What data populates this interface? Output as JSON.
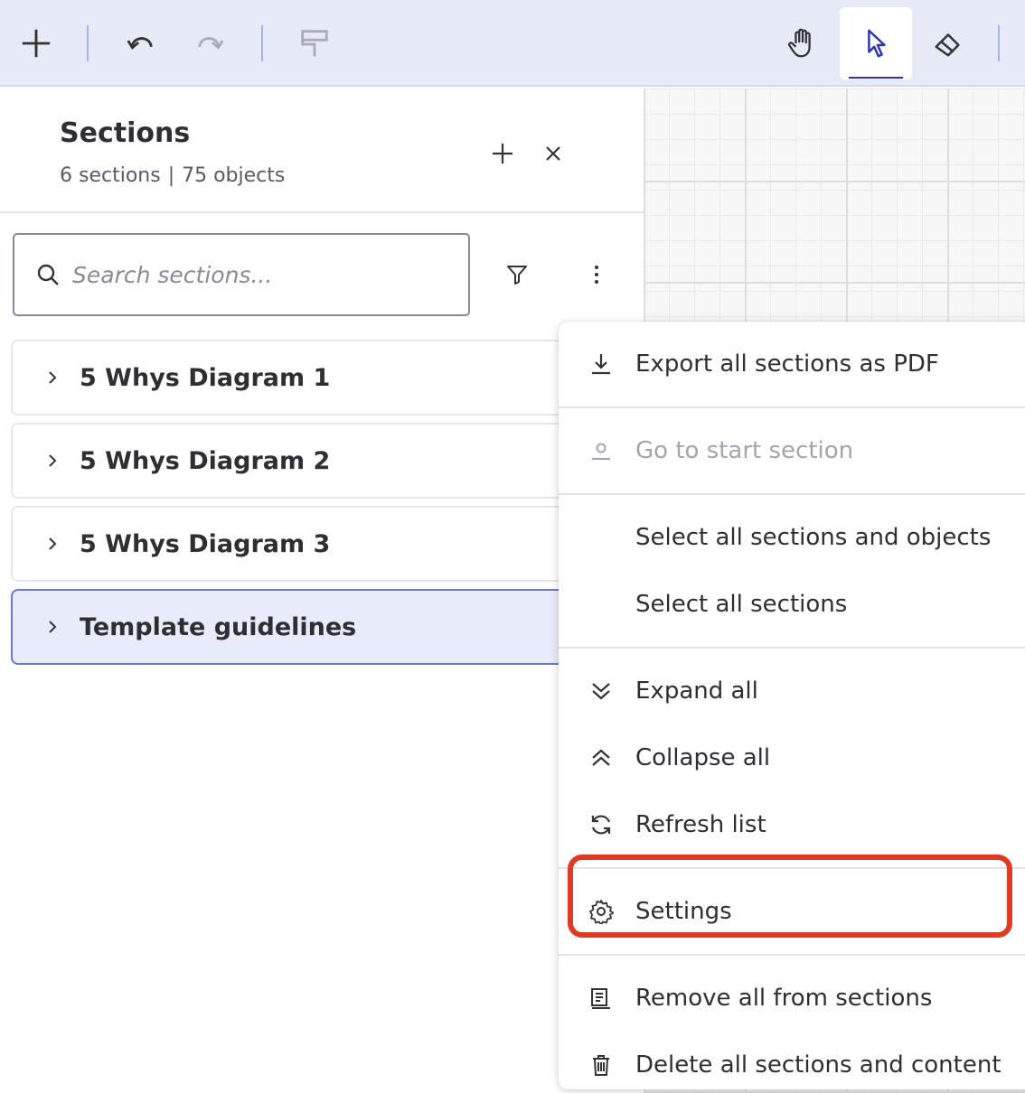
{
  "toolbar": {
    "add_icon": "plus-icon",
    "undo_icon": "undo-icon",
    "redo_icon": "redo-icon",
    "format_painter_icon": "paint-roller-icon",
    "hand_icon": "hand-icon",
    "select_icon": "pointer-icon",
    "eraser_icon": "eraser-icon",
    "accent_color": "#2a35b6"
  },
  "panel": {
    "title": "Sections",
    "sections_count": "6 sections",
    "separator": "|",
    "objects_count": "75 objects"
  },
  "search": {
    "placeholder": "Search sections..."
  },
  "sections": [
    {
      "label": "5 Whys Diagram 1",
      "selected": false
    },
    {
      "label": "5 Whys Diagram 2",
      "selected": false
    },
    {
      "label": "5 Whys Diagram 3",
      "selected": false
    },
    {
      "label": "Template guidelines",
      "selected": true
    }
  ],
  "menu": {
    "export_pdf": "Export all sections as PDF",
    "go_to_start": "Go to start section",
    "select_all_objects": "Select all sections and objects",
    "select_all_sections": "Select all sections",
    "expand_all": "Expand all",
    "collapse_all": "Collapse all",
    "refresh_list": "Refresh list",
    "settings": "Settings",
    "remove_all": "Remove all from sections",
    "delete_all": "Delete all sections and content"
  },
  "colors": {
    "highlight": "#e03a24",
    "selected_bg": "#e8ebfa"
  }
}
